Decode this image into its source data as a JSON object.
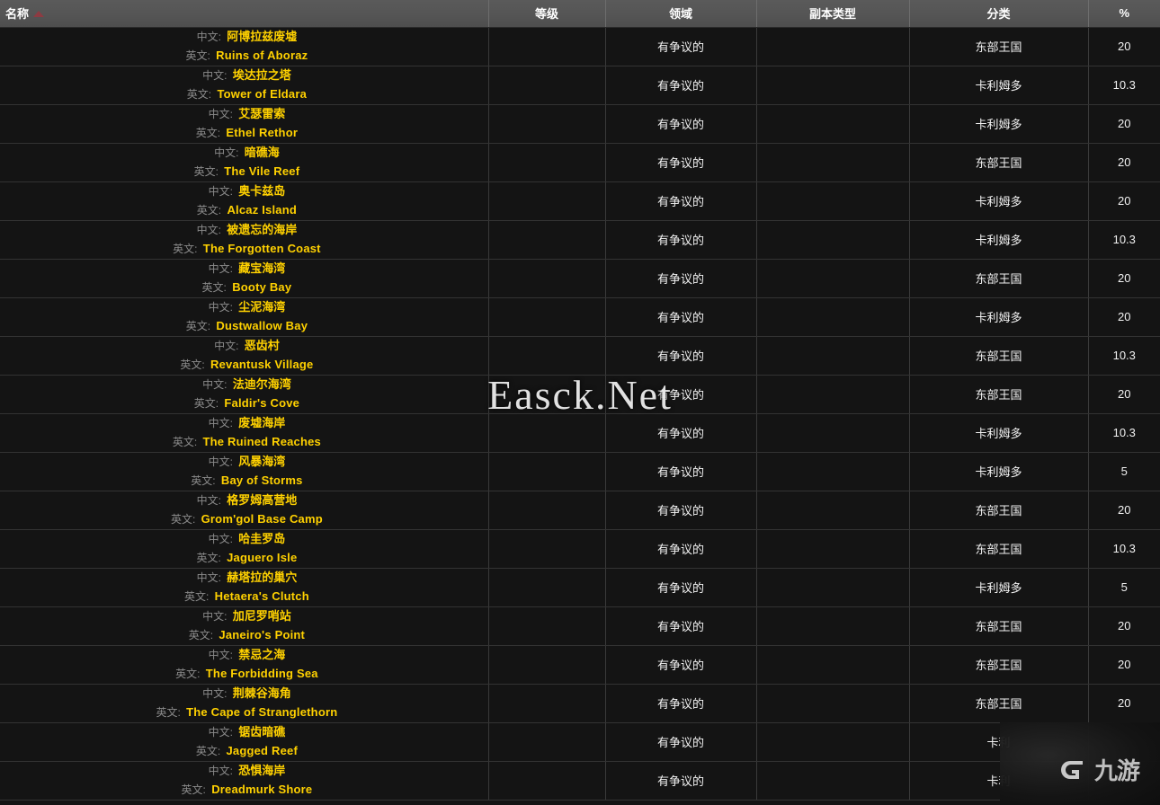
{
  "table": {
    "columns": [
      {
        "key": "name",
        "label": "名称",
        "sort": "asc"
      },
      {
        "key": "level",
        "label": "等级"
      },
      {
        "key": "domain",
        "label": "领域"
      },
      {
        "key": "instance",
        "label": "副本类型"
      },
      {
        "key": "category",
        "label": "分类"
      },
      {
        "key": "pct",
        "label": "%"
      }
    ],
    "row_labels": {
      "cn": "中文:",
      "en": "英文:"
    },
    "rows": [
      {
        "cn": "阿博拉兹废墟",
        "en": "Ruins of Aboraz",
        "level": "",
        "domain": "有争议的",
        "instance": "",
        "category": "东部王国",
        "pct": "20"
      },
      {
        "cn": "埃达拉之塔",
        "en": "Tower of Eldara",
        "level": "",
        "domain": "有争议的",
        "instance": "",
        "category": "卡利姆多",
        "pct": "10.3"
      },
      {
        "cn": "艾瑟雷索",
        "en": "Ethel Rethor",
        "level": "",
        "domain": "有争议的",
        "instance": "",
        "category": "卡利姆多",
        "pct": "20"
      },
      {
        "cn": "暗礁海",
        "en": "The Vile Reef",
        "level": "",
        "domain": "有争议的",
        "instance": "",
        "category": "东部王国",
        "pct": "20"
      },
      {
        "cn": "奥卡兹岛",
        "en": "Alcaz Island",
        "level": "",
        "domain": "有争议的",
        "instance": "",
        "category": "卡利姆多",
        "pct": "20"
      },
      {
        "cn": "被遗忘的海岸",
        "en": "The Forgotten Coast",
        "level": "",
        "domain": "有争议的",
        "instance": "",
        "category": "卡利姆多",
        "pct": "10.3"
      },
      {
        "cn": "藏宝海湾",
        "en": "Booty Bay",
        "level": "",
        "domain": "有争议的",
        "instance": "",
        "category": "东部王国",
        "pct": "20"
      },
      {
        "cn": "尘泥海湾",
        "en": "Dustwallow Bay",
        "level": "",
        "domain": "有争议的",
        "instance": "",
        "category": "卡利姆多",
        "pct": "20"
      },
      {
        "cn": "恶齿村",
        "en": "Revantusk Village",
        "level": "",
        "domain": "有争议的",
        "instance": "",
        "category": "东部王国",
        "pct": "10.3"
      },
      {
        "cn": "法迪尔海湾",
        "en": "Faldir's Cove",
        "level": "",
        "domain": "有争议的",
        "instance": "",
        "category": "东部王国",
        "pct": "20"
      },
      {
        "cn": "废墟海岸",
        "en": "The Ruined Reaches",
        "level": "",
        "domain": "有争议的",
        "instance": "",
        "category": "卡利姆多",
        "pct": "10.3"
      },
      {
        "cn": "风暴海湾",
        "en": "Bay of Storms",
        "level": "",
        "domain": "有争议的",
        "instance": "",
        "category": "卡利姆多",
        "pct": "5"
      },
      {
        "cn": "格罗姆高营地",
        "en": "Grom'gol Base Camp",
        "level": "",
        "domain": "有争议的",
        "instance": "",
        "category": "东部王国",
        "pct": "20"
      },
      {
        "cn": "哈圭罗岛",
        "en": "Jaguero Isle",
        "level": "",
        "domain": "有争议的",
        "instance": "",
        "category": "东部王国",
        "pct": "10.3"
      },
      {
        "cn": "赫塔拉的巢穴",
        "en": "Hetaera's Clutch",
        "level": "",
        "domain": "有争议的",
        "instance": "",
        "category": "卡利姆多",
        "pct": "5"
      },
      {
        "cn": "加尼罗哨站",
        "en": "Janeiro's Point",
        "level": "",
        "domain": "有争议的",
        "instance": "",
        "category": "东部王国",
        "pct": "20"
      },
      {
        "cn": "禁忌之海",
        "en": "The Forbidding Sea",
        "level": "",
        "domain": "有争议的",
        "instance": "",
        "category": "东部王国",
        "pct": "20"
      },
      {
        "cn": "荆棘谷海角",
        "en": "The Cape of Stranglethorn",
        "level": "",
        "domain": "有争议的",
        "instance": "",
        "category": "东部王国",
        "pct": "20"
      },
      {
        "cn": "锯齿暗礁",
        "en": "Jagged Reef",
        "level": "",
        "domain": "有争议的",
        "instance": "",
        "category": "卡利",
        "pct": ""
      },
      {
        "cn": "恐惧海岸",
        "en": "Dreadmurk Shore",
        "level": "",
        "domain": "有争议的",
        "instance": "",
        "category": "卡利",
        "pct": ""
      }
    ]
  },
  "watermarks": {
    "center": "Easck.Net",
    "brand_text": "九游"
  },
  "colors": {
    "header_bg": "#555555",
    "row_bg": "#141414",
    "name_value": "#ffd100",
    "name_label": "#8a8a8a",
    "sort_arrow": "#8d3b42",
    "border": "#333333"
  }
}
